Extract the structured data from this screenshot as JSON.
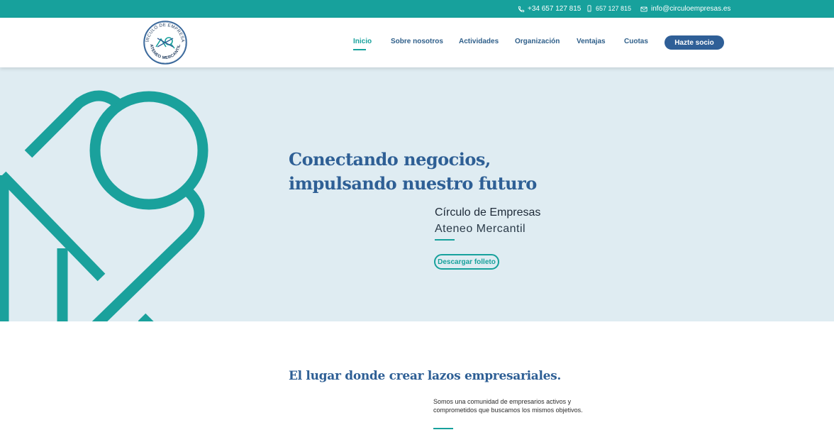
{
  "topbar": {
    "phone": "+34 657 127 815",
    "mobile": "657 127 815",
    "email": "info@circuloempresas.es",
    "icons": [
      "phone-icon",
      "mobile-icon",
      "mail-icon"
    ]
  },
  "logo": {
    "top_text": "CÍRCULO DE EMPRESAS",
    "bottom_text": "ATENEO MERCANTIL"
  },
  "nav": {
    "items": [
      {
        "label": "Inicio",
        "active": true
      },
      {
        "label": "Sobre nosotros"
      },
      {
        "label": "Actividades"
      },
      {
        "label": "Organización"
      },
      {
        "label": "Ventajas"
      },
      {
        "label": "Cuotas"
      }
    ],
    "cta_label": "Hazte socio"
  },
  "hero": {
    "title_line1": "Conectando negocios,",
    "title_line2": "impulsando nuestro futuro",
    "org_name": "Círculo de Empresas",
    "org_sub": "Ateneo Mercantil",
    "download_label": "Descargar folleto"
  },
  "section": {
    "title": "El lugar donde crear lazos empresariales.",
    "text": "Somos una comunidad de empresarios activos y comprometidos que buscamos los mismos objetivos."
  },
  "colors": {
    "teal": "#17a19c",
    "blue": "#2e5f95",
    "hero_bg": "#dfecf2"
  }
}
